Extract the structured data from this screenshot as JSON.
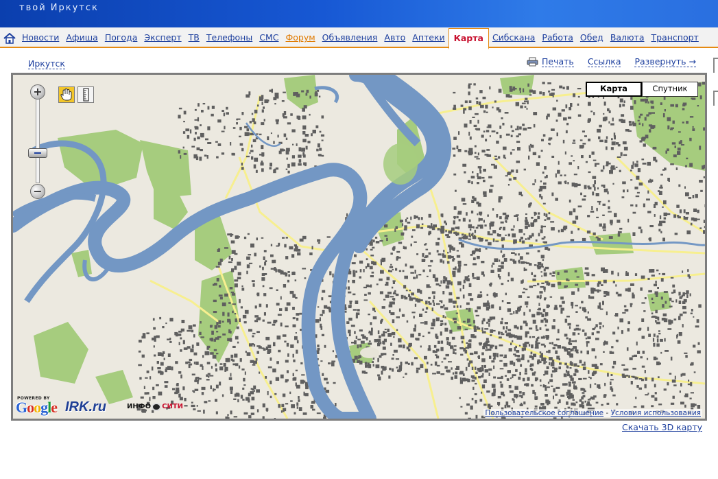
{
  "header": {
    "site_title": "твой Иркутск"
  },
  "nav": {
    "home_icon": "home-icon",
    "items": [
      {
        "label": "Новости"
      },
      {
        "label": "Афиша"
      },
      {
        "label": "Погода"
      },
      {
        "label": "Эксперт"
      },
      {
        "label": "ТВ"
      },
      {
        "label": "Телефоны"
      },
      {
        "label": "СМС"
      },
      {
        "label": "Форум"
      },
      {
        "label": "Объявления"
      },
      {
        "label": "Авто"
      },
      {
        "label": "Аптеки"
      },
      {
        "label": "Карта"
      },
      {
        "label": "Сибскана"
      },
      {
        "label": "Работа"
      },
      {
        "label": "Обед"
      },
      {
        "label": "Валюта"
      },
      {
        "label": "Транспорт"
      }
    ],
    "active": "Карта",
    "accent_color": "#e58a12"
  },
  "breadcrumb": {
    "city": "Иркутск"
  },
  "toolbar": {
    "print": "Печать",
    "link": "Ссылка",
    "expand": "Развернуть →",
    "print_icon": "printer-icon"
  },
  "map": {
    "type_controls": {
      "map": "Карта",
      "satellite": "Спутник",
      "selected": "Карта"
    },
    "zoom": {
      "in": "+",
      "out": "−"
    },
    "tools": [
      "hand-icon",
      "ruler-icon"
    ],
    "logos": {
      "powered_by": "POWERED BY",
      "google": "Google",
      "irk": "IRK.ru",
      "info_left": "ИНФО",
      "info_right": "СИТИ"
    },
    "terms": {
      "user_agreement": "Пользовательское соглашение",
      "separator": " - ",
      "terms_of_use": "Условия использования"
    },
    "colors": {
      "water": "#7397c4",
      "park": "#a6cc7e",
      "building": "#5f5f5f",
      "road": "#f7ef8f",
      "land": "#ece9e0"
    }
  },
  "footer": {
    "download_3d": "Скачать 3D карту"
  }
}
